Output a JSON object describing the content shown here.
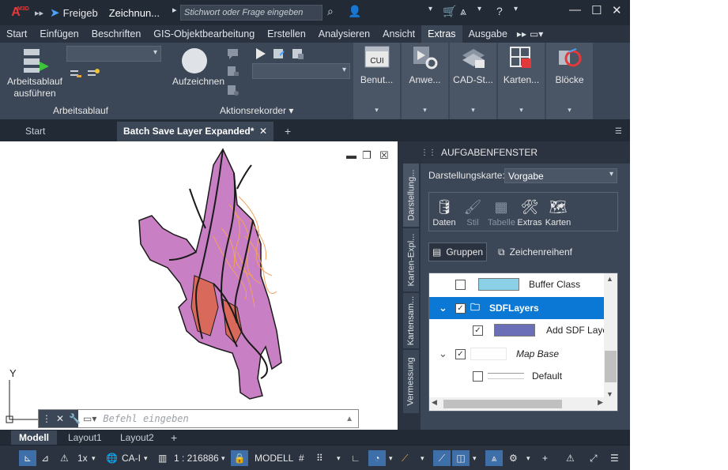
{
  "app": {
    "logo_text": "A",
    "logo_badge": "M3D",
    "share_label": "Freigeb",
    "doc_title": "Zeichnun...",
    "search_placeholder": "Stichwort oder Frage eingeben"
  },
  "ribbon_tabs": [
    "Start",
    "Einfügen",
    "Beschriften",
    "GIS-Objektbearbeitung",
    "Erstellen",
    "Analysieren",
    "Ansicht",
    "Extras",
    "Ausgabe"
  ],
  "active_ribbon_tab": "Extras",
  "ribbon": {
    "workflow_button": "Arbeitsablauf ausführen",
    "workflow_group": "Arbeitsablauf",
    "record_button": "Aufzeichnen",
    "recorder_group": "Aktionsrekorder",
    "panels": [
      {
        "label": "Benut...",
        "badge": "CUI"
      },
      {
        "label": "Anwe..."
      },
      {
        "label": "CAD-St..."
      },
      {
        "label": "Karten..."
      },
      {
        "label": "Blöcke"
      }
    ]
  },
  "file_tabs": {
    "start": "Start",
    "active": "Batch Save Layer Expanded*"
  },
  "command_line": {
    "placeholder": "Befehl eingeben"
  },
  "taskpane": {
    "title": "AUFGABENFENSTER",
    "vertical_tabs": [
      "Darstellung...",
      "Karten-Expl...",
      "Kartensam...",
      "Vermessung"
    ],
    "display_map_label": "Darstellungskarte:",
    "display_map_value": "Vorgabe",
    "tools": [
      {
        "label": "Daten",
        "enabled": true
      },
      {
        "label": "Stil",
        "enabled": false
      },
      {
        "label": "Tabelle",
        "enabled": false
      },
      {
        "label": "Extras",
        "enabled": true
      },
      {
        "label": "Karten",
        "enabled": true
      }
    ],
    "groups_button": "Gruppen",
    "draw_order_button": "Zeichenreihenf",
    "tree": [
      {
        "label": "Buffer Class",
        "checked": false,
        "swatch": "#8ad0e6"
      },
      {
        "label": "SDFLayers",
        "checked": true,
        "selected": true
      },
      {
        "label": "Add SDF Layer",
        "checked": true,
        "swatch": "#6b6fb8"
      },
      {
        "label": "Map Base",
        "checked": true
      },
      {
        "label": "Default",
        "checked": false
      }
    ]
  },
  "layout_tabs": [
    "Modell",
    "Layout1",
    "Layout2"
  ],
  "active_layout": "Modell",
  "status": {
    "scale_factor": "1x",
    "coord_system": "CA-I",
    "scale": "1 : 216886",
    "model_label": "MODELL"
  },
  "colors": {
    "accent": "#0a78d4",
    "ribbon_bg": "#3b4656",
    "titlebar_bg": "#222a36",
    "map_purple": "#c97fc4",
    "map_orange": "#f2a25a",
    "map_red": "#d9695a"
  }
}
